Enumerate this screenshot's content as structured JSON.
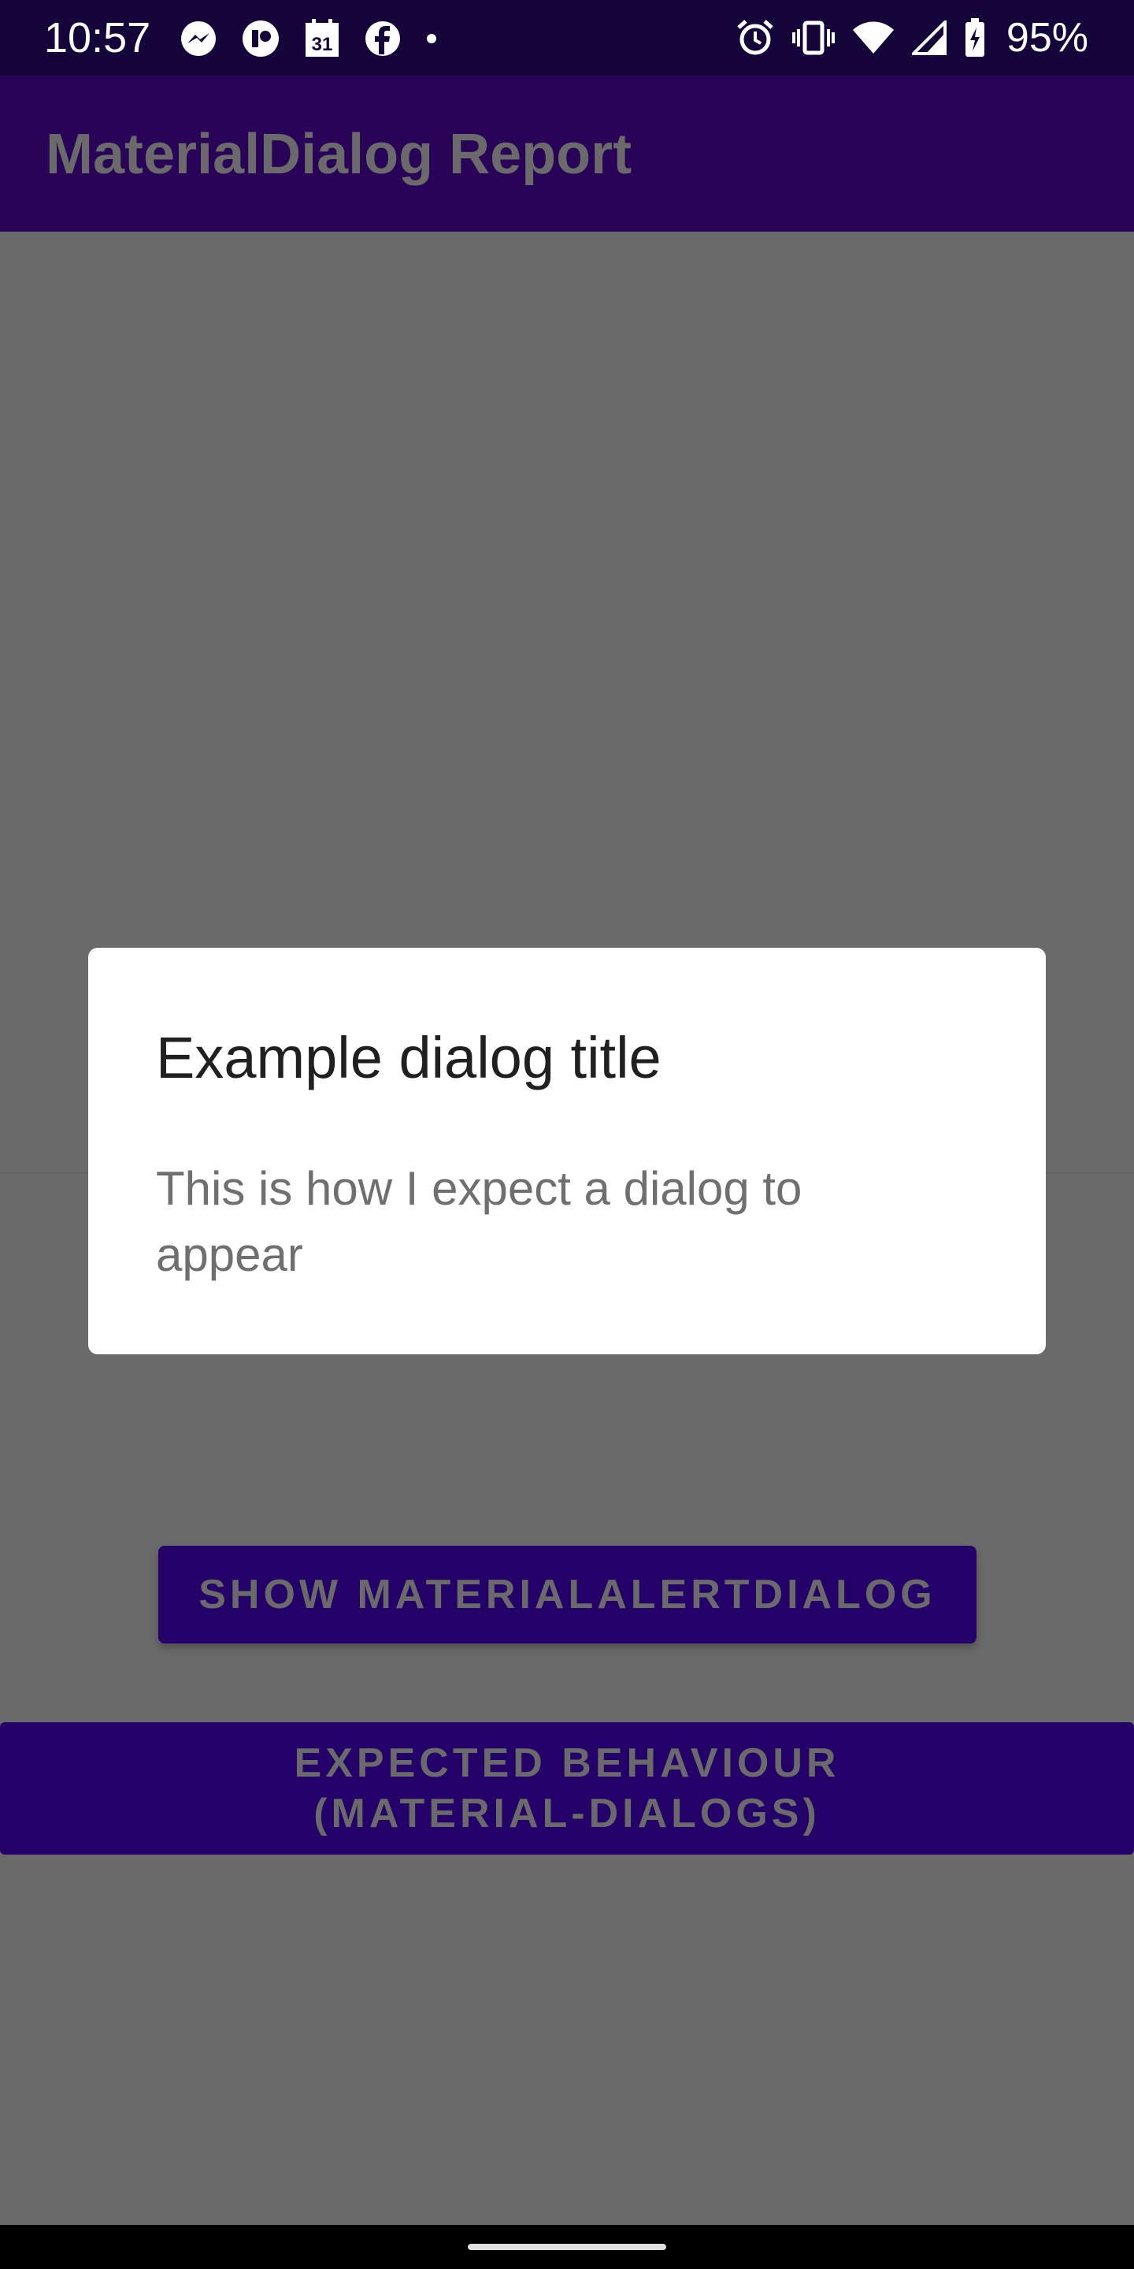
{
  "status_bar": {
    "time": "10:57",
    "battery": "95%",
    "left_icons": [
      "messenger-icon",
      "app-icon",
      "calendar-icon",
      "facebook-icon",
      "dot-icon"
    ],
    "right_icons": [
      "alarm-icon",
      "vibrate-icon",
      "wifi-icon",
      "signal-icon",
      "battery-icon"
    ],
    "calendar_day": "31"
  },
  "app_bar": {
    "title": "MaterialDialog Report"
  },
  "dialog": {
    "title": "Example dialog title",
    "message": "This is how I expect a dialog to appear"
  },
  "buttons": {
    "show_label": "SHOW MATERIALALERTDIALOG",
    "expected_line1": "EXPECTED BEHAVIOUR",
    "expected_line2": "(MATERIAL-DIALOGS)"
  },
  "colors": {
    "status_bar": "#14043a",
    "app_bar": "#280357",
    "scrim": "#6a6a6a",
    "button": "#240069",
    "dialog": "#ffffff"
  }
}
